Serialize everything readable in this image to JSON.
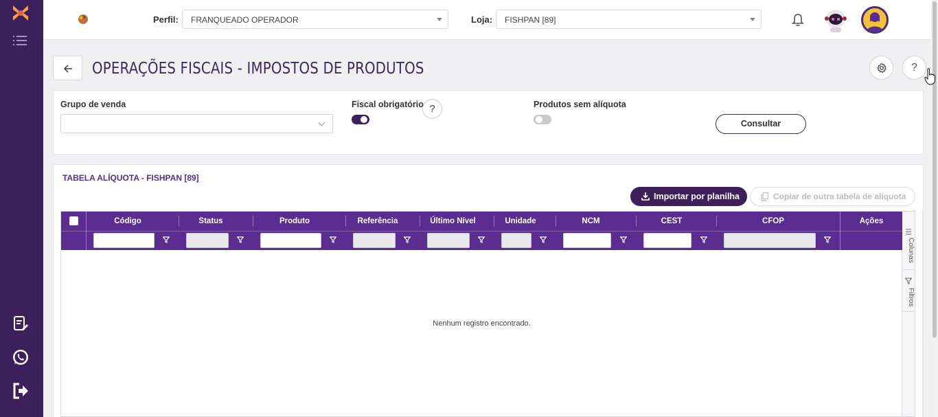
{
  "sidebar": {
    "items": [
      {
        "icon": "logo-icon"
      },
      {
        "icon": "menu-icon"
      },
      {
        "icon": "document-edit-icon"
      },
      {
        "icon": "whatsapp-icon"
      },
      {
        "icon": "logout-icon"
      }
    ]
  },
  "topbar": {
    "perfil_label": "Perfil:",
    "perfil_value": "FRANQUEADO OPERADOR",
    "loja_label": "Loja:",
    "loja_value": "FISHPAN [89]"
  },
  "header": {
    "title": "OPERAÇÕES FISCAIS - IMPOSTOS DE PRODUTOS",
    "settings_icon": "gear-icon",
    "help_label": "?"
  },
  "filters": {
    "grupo_label": "Grupo de venda",
    "grupo_value": "",
    "fiscal_label": "Fiscal obrigatório",
    "fiscal_on": true,
    "fiscal_help": "?",
    "sem_aliquota_label": "Produtos sem alíquota",
    "sem_aliquota_on": false,
    "consultar_label": "Consultar"
  },
  "table_section": {
    "title": "TABELA ALÍQUOTA - FISHPAN [89]",
    "import_label": "Importar por planilha",
    "copy_label": "Copiar de outra tabela de alíquota"
  },
  "grid": {
    "columns": [
      "Código",
      "Status",
      "Produto",
      "Referência",
      "Último Nível",
      "Unidade",
      "NCM",
      "CEST",
      "CFOP",
      "Ações"
    ],
    "empty_message": "Nenhum registro encontrado.",
    "side_tabs": [
      "Colunas",
      "Filtros"
    ]
  },
  "colors": {
    "sidebar": "#3d1f5c",
    "grid_header": "#5c2d91",
    "title": "#3d2a5a",
    "section_title": "#5a2e8a"
  }
}
